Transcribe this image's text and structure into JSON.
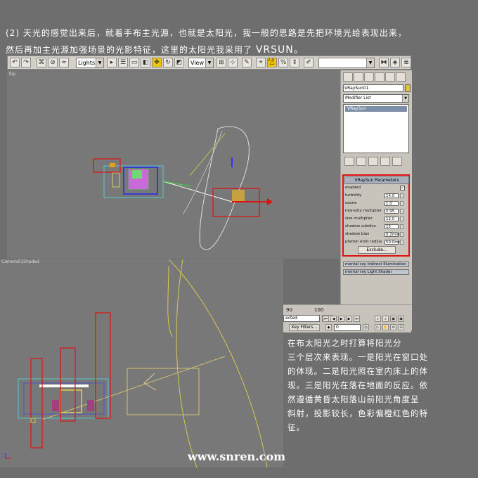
{
  "intro": {
    "line1": "(2) 天光的感觉出来后，就着手布主光源，也就是太阳光，我一般的思路是先把环境光给表现出来，",
    "line2_text": "然后再加主光源加强场景的光影特征，这里的太阳光我采用了",
    "line2_highlight": "VRSUN。"
  },
  "toolbar": {
    "selection_filter": "Lights",
    "reference_coord": "View",
    "angle_snap_label": "2.5",
    "named_selection": ""
  },
  "viewport_top": {
    "label": "Top"
  },
  "viewport_bottom": {
    "label": "Camera01Shaded"
  },
  "command_panel": {
    "object_name": "VRaySun01",
    "modifier_list": "Modifier List",
    "stack_item": "VRaySun",
    "rollout_title": "VRaySun Parameters",
    "params": [
      {
        "label": "enabled",
        "value": "",
        "checkbox": true,
        "checked": "✓"
      },
      {
        "label": "turbidity",
        "value": "14.0"
      },
      {
        "label": "ozone",
        "value": "1.0"
      },
      {
        "label": "intensity multiplier",
        "value": "0.95"
      },
      {
        "label": "size multiplier",
        "value": "12.0"
      },
      {
        "label": "shadow subdivs",
        "value": "15"
      },
      {
        "label": "shadow bias",
        "value": "0.2mm"
      },
      {
        "label": "photon emit radius",
        "value": "50.0mr"
      }
    ],
    "exclude_label": "Exclude...",
    "rollout_mr_indirect": "mental ray Indirect Illumination",
    "rollout_mr_shader": "mental ray Light Shader"
  },
  "timeline": {
    "tick_90": "90",
    "tick_100": "100"
  },
  "bottom_controls": {
    "selection_dropdown": "ected",
    "key_filters": "Key Filters...",
    "frame": "0"
  },
  "description": {
    "lines": [
      "在布太阳光之时打算将阳光分",
      "三个层次来表现。一是阳光在窗口处",
      "的体现。二是阳光照在室内床上的体",
      "现。三是阳光在落在地面的反应。依",
      "然遵循黄昏太阳落山前阳光角度呈",
      "斜射，投影较长，色彩偏橙红色的特",
      "征。"
    ]
  },
  "watermark": "www.snren.com",
  "colors": {
    "highlight_red": "#e01010",
    "viewport_gray": "#787878",
    "panel_gray": "#c8c4bc"
  }
}
